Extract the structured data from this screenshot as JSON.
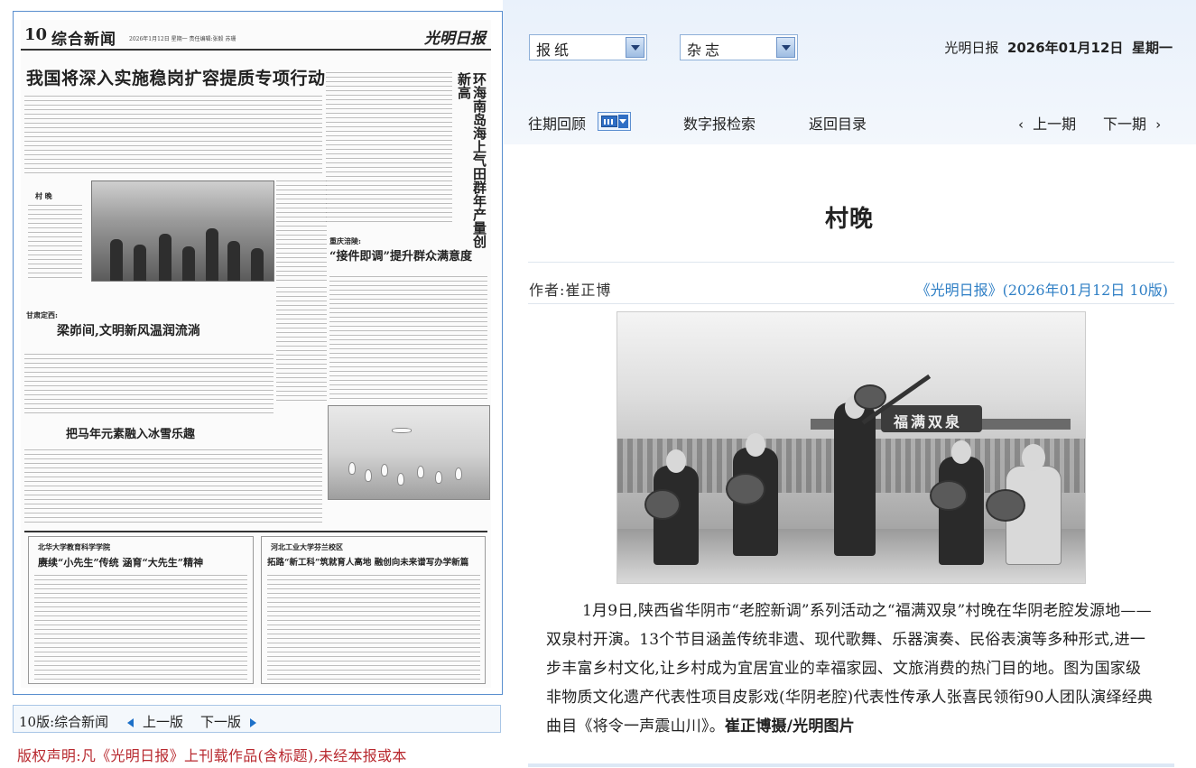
{
  "paper": {
    "page_number": "10",
    "section_name": "综合新闻",
    "header_meta": "2026年1月12日  星期一  责任编辑:张毅  苏珊",
    "logo_text": "光明日报",
    "main_headline": "我国将深入实施稳岗扩容提质专项行动",
    "side_headline": "环海南岛海上气田群年产量创新高",
    "photo_caption_title": "村  晚",
    "sub_label_1": "重庆涪陵:",
    "headline_2": "“接件即调”提升群众满意度",
    "sub_label_2": "甘肃定西:",
    "headline_3": "梁峁间,文明新风温润流淌",
    "headline_4": "把马年元素融入冰雪乐趣",
    "ad_left_school": "北华大学教育科学学院",
    "ad_left_headline": "赓续“小先生”传统    涵育“大先生”精神",
    "ad_right_school": "河北工业大学芬兰校区",
    "ad_right_headline": "拓路“新工科”筑就育人高地    融创向未来谱写办学新篇"
  },
  "pager": {
    "current": "10版:综合新闻",
    "prev": "上一版",
    "next": "下一版"
  },
  "copyright": "版权声明:凡《光明日报》上刊载作品(含标题),未经本报或本",
  "toolbar": {
    "select_newspaper": "报纸",
    "select_magazine": "杂志",
    "issue_paper": "光明日报",
    "issue_date": "2026年01月12日",
    "issue_weekday": "星期一",
    "past_review": "往期回顾",
    "digital_search": "数字报检索",
    "back_to_toc": "返回目录",
    "prev_issue": "上一期",
    "next_issue": "下一期"
  },
  "article": {
    "title": "村晚",
    "author": "作者:崔正博",
    "source": "《光明日报》(2026年01月12日    10版)",
    "body": "1月9日,陕西省华阴市“老腔新调”系列活动之“福满双泉”村晚在华阴老腔发源地——双泉村开演。13个节目涵盖传统非遗、现代歌舞、乐器演奏、民俗表演等多种形式,进一步丰富乡村文化,让乡村成为宜居宜业的幸福家园、文旅消费的热门目的地。图为国家级非物质文化遗产代表性项目皮影戏(华阴老腔)代表性传承人张喜民领衔90人团队演绎经典曲目《将令一声震山川》。",
    "credit": "崔正博摄/光明图片",
    "photo_sign": "福满双泉"
  }
}
